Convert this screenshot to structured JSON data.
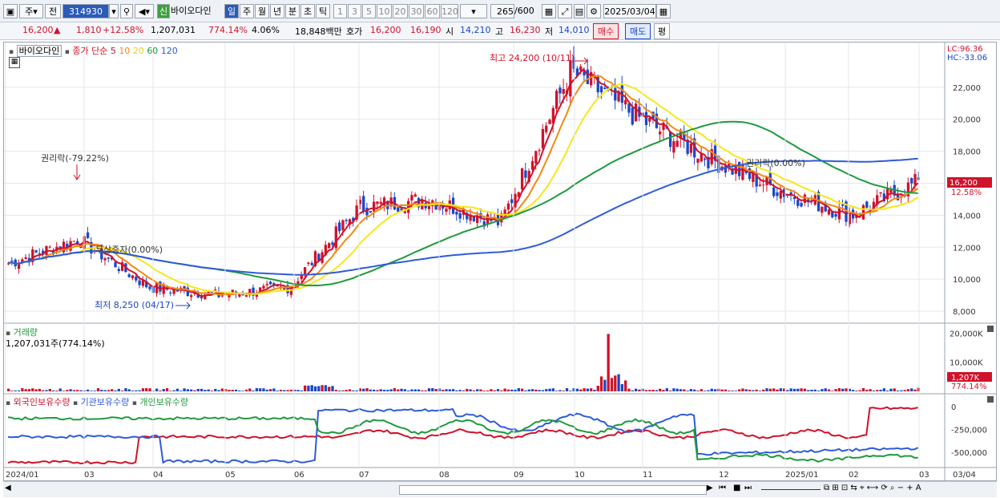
{
  "toolbar": {
    "market_btn": "주",
    "prev_btn": "전",
    "stock_code": "314930",
    "stock_name_tag": "신",
    "stock_name": "바이오다인",
    "periods": [
      "일",
      "주",
      "월",
      "년",
      "분",
      "초",
      "틱"
    ],
    "active_period": "일",
    "intervals": [
      "1",
      "3",
      "5",
      "10",
      "20",
      "30",
      "60",
      "120"
    ],
    "count_label": "265",
    "count_total": "/600",
    "date": "2025/03/04"
  },
  "quote": {
    "price": "16,200",
    "change": "1,810",
    "change_pct": "+12.58%",
    "volume": "1,207,031",
    "volume_ratio": "774.14%",
    "turnover": "4.06%",
    "amount": "18,848백만",
    "ask_label": "호가",
    "ask": "16,200",
    "bid": "16,190",
    "open_label": "시",
    "open": "14,210",
    "high_label": "고",
    "high": "16,230",
    "low_label": "저",
    "low": "14,010",
    "buy_btn": "매수",
    "sell_btn": "매도",
    "eval_btn": "평"
  },
  "price_panel": {
    "stock_name": "바이오다인",
    "ma_title": "종가 단순",
    "ma_periods": [
      "5",
      "10",
      "20",
      "60",
      "120"
    ],
    "ma_colors": [
      "#d0122a",
      "#f08a12",
      "#f5e81a",
      "#1e9a3c",
      "#2f5bd8"
    ],
    "lc_label": "LC:96.36",
    "hc_label": "HC:-33.06",
    "annot_high": "최고 24,200 (10/11)",
    "annot_low": "최저 8,250 (04/17)",
    "annot_rights": "권리락(-79.22%)",
    "annot_free": "무상증자(0.00%)",
    "annot_rights2": "권리락(0.00%)",
    "last_price_tag": "16,200",
    "last_pct_tag": "12.58%",
    "y_ticks": [
      "22,000",
      "20,000",
      "18,000",
      "16,000",
      "14,000",
      "12,000",
      "10,000",
      "8,000"
    ]
  },
  "volume_panel": {
    "title": "거래량",
    "value": "1,207,031주(774.14%)",
    "y_ticks": [
      "20,000K",
      "10,000K"
    ],
    "last_tag": "1,207K",
    "last_pct": "774.14%"
  },
  "holder_panel": {
    "legend": [
      "외국인보유수량",
      "기관보유수량",
      "개인보유수량"
    ],
    "legend_colors": [
      "#d0122a",
      "#2f5bd8",
      "#1e9a3c"
    ],
    "y_ticks": [
      "0",
      "-250,000",
      "-500,000"
    ]
  },
  "x_axis": [
    "2024/01",
    "03",
    "04",
    "05",
    "06",
    "07",
    "08",
    "09",
    "10",
    "11",
    "12",
    "2025/01",
    "02",
    "03",
    "03/04"
  ],
  "chart_data": {
    "type": "candlestick",
    "title": "바이오다인",
    "x": [
      "2024/01",
      "03",
      "04",
      "05",
      "06",
      "07",
      "08",
      "09",
      "10",
      "11",
      "12",
      "2025/01",
      "02",
      "03"
    ],
    "ma5_close": [
      11000,
      12500,
      9500,
      9000,
      9500,
      14500,
      15000,
      13500,
      23000,
      20000,
      17500,
      15500,
      14000,
      16200
    ],
    "ma120_close": [
      11500,
      11200,
      11000,
      10700,
      10500,
      11200,
      12000,
      12500,
      14500,
      16000,
      16800,
      17000,
      17000,
      16900
    ],
    "ylim": [
      7500,
      24500
    ],
    "high": {
      "value": 24200,
      "date": "10/11"
    },
    "low": {
      "value": 8250,
      "date": "04/17"
    }
  }
}
